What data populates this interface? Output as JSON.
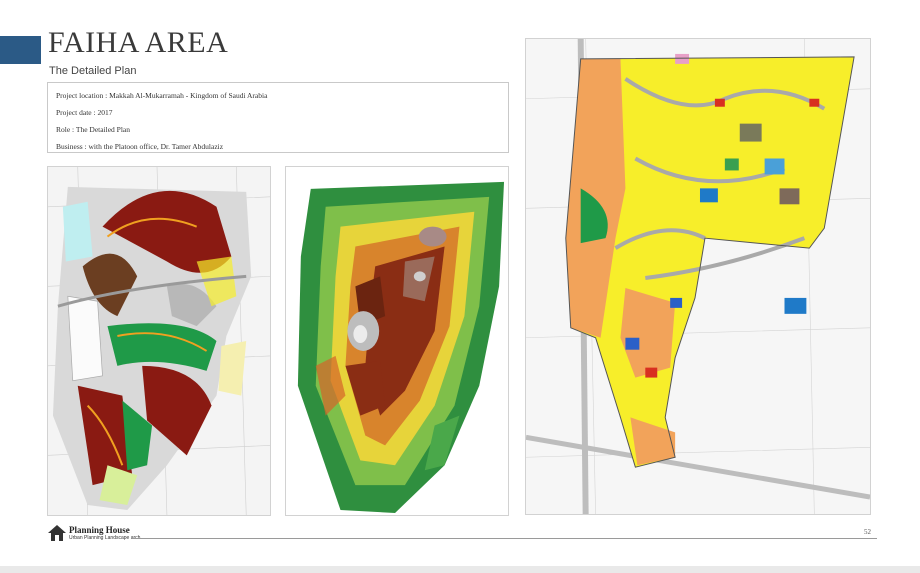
{
  "header": {
    "title": "FAIHA AREA",
    "subtitle": "The Detailed Plan"
  },
  "project_info": [
    "Project location : Makkah Al-Mukarramah - Kingdom of Saudi Arabia",
    "Project date : 2017",
    "Role : The Detailed Plan",
    "Business : with the Platoon office, Dr. Tamer Abdulaziz"
  ],
  "footer": {
    "logo_name": "Planning House",
    "logo_tagline": "Urban Planning Landscape arch.",
    "page_number": "52"
  },
  "colors": {
    "accent": "#2b5a86",
    "residential_yellow": "#f7ee2a",
    "commercial_orange": "#f2a35a",
    "green_space": "#1f9a48",
    "landuse_red": "#8a1a12",
    "road_gray": "#a9a9a9"
  }
}
